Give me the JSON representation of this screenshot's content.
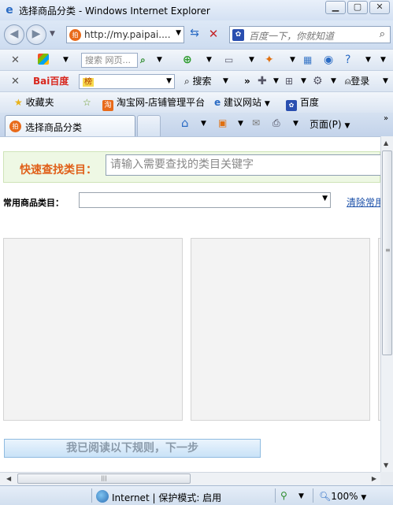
{
  "window": {
    "title": "选择商品分类 - Windows Internet Explorer",
    "icon": "ie-icon",
    "controls": [
      "minimize",
      "maximize",
      "close"
    ]
  },
  "address_bar": {
    "url": "http://my.paipai....",
    "search_placeholder": "百度一下，你就知道"
  },
  "toolbar1": {
    "search_placeholder": "搜索 网页..."
  },
  "toolbar2": {
    "brand": "Bai百度",
    "input_value": "榜",
    "search_label": "搜索",
    "more": "»",
    "login_label": "登录"
  },
  "favorites_bar": {
    "favorites_label": "收藏夹",
    "items": [
      "淘宝网-店铺管理平台",
      "建议网站",
      "百度"
    ]
  },
  "tabs": {
    "active_tab": "选择商品分类",
    "page_menu": "页面(P)"
  },
  "page": {
    "quick_find_label": "快速查找类目：",
    "quick_find_placeholder": "请输入需要查找的类目关键字",
    "common_category_label": "常用商品类目：",
    "common_category_value": "",
    "clear_link": "清除常用",
    "next_button": "我已阅读以下规则，下一步"
  },
  "status_bar": {
    "zone": "Internet | 保护模式: 启用",
    "zoom": "100%"
  },
  "colors": {
    "quick_label": "#e0601a",
    "quick_bg": "#eef8e4",
    "link": "#1a4fa8",
    "button_bg": "#c9e2f7"
  }
}
